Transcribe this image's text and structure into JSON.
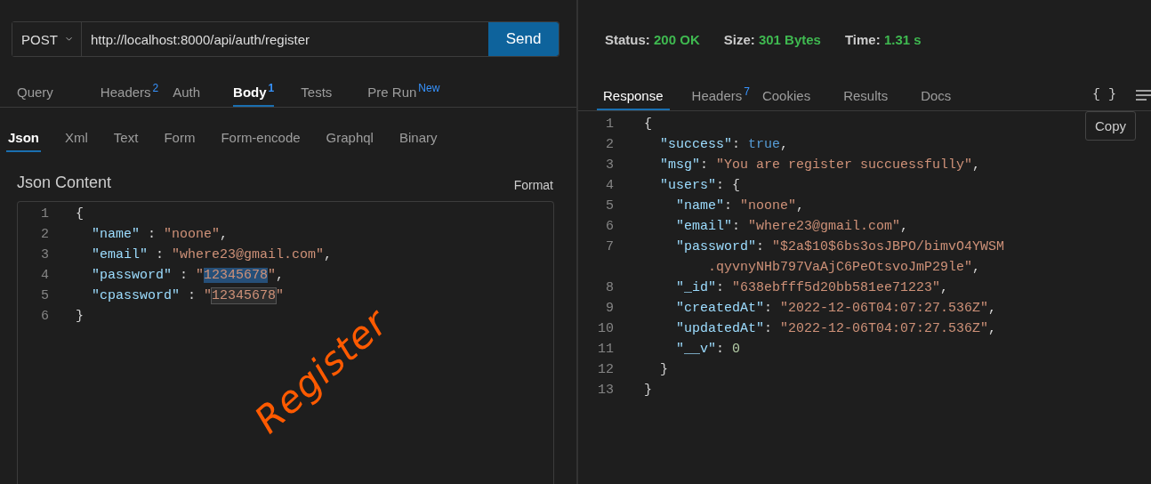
{
  "request": {
    "method": "POST",
    "url": "http://localhost:8000/api/auth/register",
    "send_label": "Send",
    "tabs": [
      {
        "label": "Query",
        "selected": false
      },
      {
        "label": "Headers",
        "badge": "2",
        "selected": false
      },
      {
        "label": "Auth",
        "selected": false
      },
      {
        "label": "Body",
        "badge": "1",
        "selected": true
      },
      {
        "label": "Tests",
        "selected": false
      },
      {
        "label": "Pre Run",
        "badge": "New",
        "selected": false
      }
    ],
    "body_tabs": [
      {
        "label": "Json",
        "selected": true
      },
      {
        "label": "Xml",
        "selected": false
      },
      {
        "label": "Text",
        "selected": false
      },
      {
        "label": "Form",
        "selected": false
      },
      {
        "label": "Form-encode",
        "selected": false
      },
      {
        "label": "Graphql",
        "selected": false
      },
      {
        "label": "Binary",
        "selected": false
      }
    ],
    "content_title": "Json Content",
    "format_label": "Format",
    "editor": {
      "lines": [
        {
          "number": "1",
          "tokens": [
            {
              "kind": "punct",
              "text": "{"
            }
          ]
        },
        {
          "number": "2",
          "tokens": [
            {
              "kind": "key",
              "text": "  \"name\""
            },
            {
              "kind": "punct",
              "text": " : "
            },
            {
              "kind": "str",
              "text": "\"noone\""
            },
            {
              "kind": "punct",
              "text": ","
            }
          ]
        },
        {
          "number": "3",
          "tokens": [
            {
              "kind": "key",
              "text": "  \"email\""
            },
            {
              "kind": "punct",
              "text": " : "
            },
            {
              "kind": "str",
              "text": "\"where23@gmail.com\""
            },
            {
              "kind": "punct",
              "text": ","
            }
          ]
        },
        {
          "number": "4",
          "tokens": [
            {
              "kind": "key",
              "text": "  \"password\""
            },
            {
              "kind": "punct",
              "text": " : "
            },
            {
              "kind": "str",
              "text": "\""
            },
            {
              "kind": "str",
              "text": "12345678",
              "selected": true
            },
            {
              "kind": "str",
              "text": "\""
            },
            {
              "kind": "punct",
              "text": ","
            }
          ]
        },
        {
          "number": "5",
          "tokens": [
            {
              "kind": "key",
              "text": "  \"cpassword\""
            },
            {
              "kind": "punct",
              "text": " : "
            },
            {
              "kind": "str",
              "text": "\""
            },
            {
              "kind": "str",
              "text": "12345678",
              "highlighted": true
            },
            {
              "kind": "str",
              "text": "\""
            }
          ]
        },
        {
          "number": "6",
          "tokens": [
            {
              "kind": "punct",
              "text": "}"
            }
          ]
        }
      ]
    }
  },
  "annotation": {
    "text": "Register",
    "color": "#ff5a00"
  },
  "response": {
    "status": [
      {
        "label": "Status:",
        "value": "200 OK"
      },
      {
        "label": "Size:",
        "value": "301 Bytes"
      },
      {
        "label": "Time:",
        "value": "1.31 s"
      }
    ],
    "tabs": [
      {
        "label": "Response",
        "selected": true
      },
      {
        "label": "Headers",
        "badge": "7",
        "selected": false
      },
      {
        "label": "Cookies",
        "selected": false
      },
      {
        "label": "Results",
        "selected": false
      },
      {
        "label": "Docs",
        "selected": false
      }
    ],
    "view_toggle": "{ }",
    "copy_label": "Copy",
    "viewer": {
      "lines": [
        {
          "number": "1",
          "tokens": [
            {
              "kind": "punct",
              "text": "{"
            }
          ]
        },
        {
          "number": "2",
          "tokens": [
            {
              "kind": "key",
              "text": "  \"success\""
            },
            {
              "kind": "punct",
              "text": ": "
            },
            {
              "kind": "bool",
              "text": "true"
            },
            {
              "kind": "punct",
              "text": ","
            }
          ]
        },
        {
          "number": "3",
          "tokens": [
            {
              "kind": "key",
              "text": "  \"msg\""
            },
            {
              "kind": "punct",
              "text": ": "
            },
            {
              "kind": "str",
              "text": "\"You are register succuessfully\""
            },
            {
              "kind": "punct",
              "text": ","
            }
          ]
        },
        {
          "number": "4",
          "tokens": [
            {
              "kind": "key",
              "text": "  \"users\""
            },
            {
              "kind": "punct",
              "text": ": {"
            }
          ]
        },
        {
          "number": "5",
          "tokens": [
            {
              "kind": "key",
              "text": "    \"name\""
            },
            {
              "kind": "punct",
              "text": ": "
            },
            {
              "kind": "str",
              "text": "\"noone\""
            },
            {
              "kind": "punct",
              "text": ","
            }
          ]
        },
        {
          "number": "6",
          "tokens": [
            {
              "kind": "key",
              "text": "    \"email\""
            },
            {
              "kind": "punct",
              "text": ": "
            },
            {
              "kind": "str",
              "text": "\"where23@gmail.com\""
            },
            {
              "kind": "punct",
              "text": ","
            }
          ]
        },
        {
          "number": "7",
          "tokens": [
            {
              "kind": "key",
              "text": "    \"password\""
            },
            {
              "kind": "punct",
              "text": ": "
            },
            {
              "kind": "str",
              "text": "\"$2a$10$6bs3osJBPO/bimvO4YWSM"
            }
          ]
        },
        {
          "tokens": [
            {
              "kind": "str",
              "text": "        .qyvnyNHb797VaAjC6PeOtsvoJmP29le\""
            },
            {
              "kind": "punct",
              "text": ","
            }
          ]
        },
        {
          "number": "8",
          "tokens": [
            {
              "kind": "key",
              "text": "    \"_id\""
            },
            {
              "kind": "punct",
              "text": ": "
            },
            {
              "kind": "str",
              "text": "\"638ebfff5d20bb581ee71223\""
            },
            {
              "kind": "punct",
              "text": ","
            }
          ]
        },
        {
          "number": "9",
          "tokens": [
            {
              "kind": "key",
              "text": "    \"createdAt\""
            },
            {
              "kind": "punct",
              "text": ": "
            },
            {
              "kind": "str",
              "text": "\"2022-12-06T04:07:27.536Z\""
            },
            {
              "kind": "punct",
              "text": ","
            }
          ]
        },
        {
          "number": "10",
          "tokens": [
            {
              "kind": "key",
              "text": "    \"updatedAt\""
            },
            {
              "kind": "punct",
              "text": ": "
            },
            {
              "kind": "str",
              "text": "\"2022-12-06T04:07:27.536Z\""
            },
            {
              "kind": "punct",
              "text": ","
            }
          ]
        },
        {
          "number": "11",
          "tokens": [
            {
              "kind": "key",
              "text": "    \"__v\""
            },
            {
              "kind": "punct",
              "text": ": "
            },
            {
              "kind": "num",
              "text": "0"
            }
          ]
        },
        {
          "number": "12",
          "tokens": [
            {
              "kind": "punct",
              "text": "  }"
            }
          ]
        },
        {
          "number": "13",
          "tokens": [
            {
              "kind": "punct",
              "text": "}"
            }
          ]
        }
      ]
    }
  }
}
